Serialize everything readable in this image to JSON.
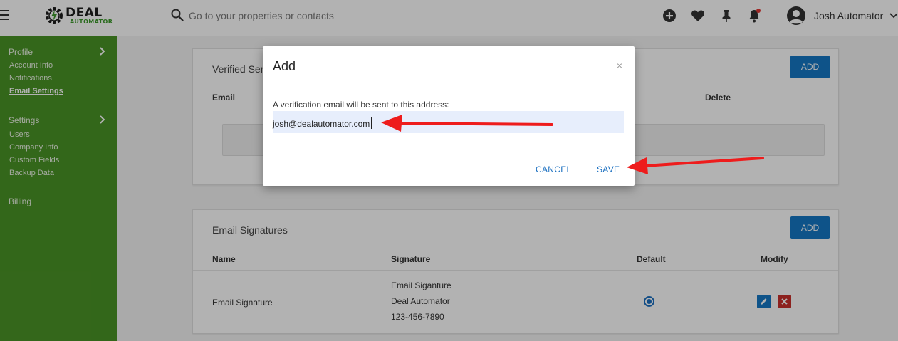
{
  "header": {
    "logo_text": "DEAL",
    "logo_subtext": "AUTOMATOR",
    "search_placeholder": "Go to your properties or contacts",
    "user_name": "Josh Automator"
  },
  "sidebar": {
    "profile_title": "Profile",
    "profile_items": [
      "Account Info",
      "Notifications",
      "Email Settings"
    ],
    "settings_title": "Settings",
    "settings_items": [
      "Users",
      "Company Info",
      "Custom Fields",
      "Backup Data"
    ],
    "billing": "Billing"
  },
  "verified_card": {
    "title": "Verified Ser",
    "add_label": "ADD",
    "columns": [
      "Email",
      "Delete"
    ]
  },
  "signatures_card": {
    "title": "Email Signatures",
    "add_label": "ADD",
    "columns": [
      "Name",
      "Signature",
      "Default",
      "Modify"
    ],
    "rows": [
      {
        "name": "Email Signature",
        "signature_lines": [
          "Email Siganture",
          "Deal Automator",
          "123-456-7890"
        ],
        "default": true
      }
    ]
  },
  "modal": {
    "title": "Add",
    "close_symbol": "×",
    "label": "A verification email will be sent to this address:",
    "email_value": "josh@dealautomator.com",
    "cancel_label": "CANCEL",
    "save_label": "SAVE"
  },
  "colors": {
    "sidebar": "#4a9426",
    "primary": "#1577c4",
    "danger": "#c9302c",
    "arrow": "#ee1c1c"
  }
}
